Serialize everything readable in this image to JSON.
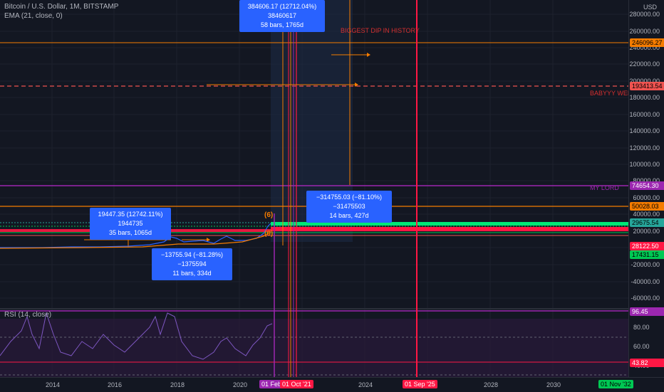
{
  "header": {
    "symbol_title": "Bitcoin / U.S. Dollar, 1M, BITSTAMP",
    "ema_label": "EMA (21, close, 0)",
    "rsi_label": "RSI (14, close)"
  },
  "price_axis": {
    "currency": "USD",
    "ticks": [
      "280000.00",
      "260000.00",
      "240000.00",
      "220000.00",
      "200000.00",
      "180000.00",
      "160000.00",
      "140000.00",
      "120000.00",
      "100000.00",
      "80000.00",
      "60000.00",
      "40000.00",
      "20000.00",
      "0.00",
      "-20000.00",
      "-40000.00",
      "-60000.00"
    ],
    "labels": [
      {
        "text": "246096.27",
        "bg": "#f57c00",
        "fg": "#000000"
      },
      {
        "text": "193413.54",
        "bg": "#ef5350",
        "fg": "#000000"
      },
      {
        "text": "74654.30",
        "bg": "#9c27b0",
        "fg": "#ffffff"
      },
      {
        "text": "50028.03",
        "bg": "#f57c00",
        "fg": "#000000"
      },
      {
        "text": "29675.54",
        "bg": "#26a69a",
        "fg": "#000000"
      },
      {
        "text": "28122.50",
        "bg": "#ff1744",
        "fg": "#ffffff"
      },
      {
        "text": "17431.15",
        "bg": "#00c853",
        "fg": "#000000"
      }
    ]
  },
  "rsi_axis": {
    "ticks": [
      "80.00",
      "60.00",
      "40.00"
    ],
    "labels": [
      {
        "text": "96.45",
        "bg": "#9c27b0",
        "fg": "#ffffff"
      },
      {
        "text": "43.82",
        "bg": "#ff1744",
        "fg": "#ffffff"
      }
    ]
  },
  "time_axis": {
    "ticks": [
      "2014",
      "2016",
      "2018",
      "2020",
      "2022",
      "2024",
      "2026",
      "2028",
      "2030"
    ],
    "markers": [
      {
        "text": "01 Feb '21",
        "bg": "#9c27b0",
        "fg": "#ffffff"
      },
      {
        "text": "01 Oct '21",
        "bg": "#ff1744",
        "fg": "#ffffff"
      },
      {
        "text": "01 Sep '25",
        "bg": "#ff1744",
        "fg": "#ffffff"
      },
      {
        "text": "01 Nov '32",
        "bg": "#00c853",
        "fg": "#000000"
      }
    ]
  },
  "annotations": {
    "biggest_dip": "BIGGEST DIP IN HISTORY",
    "babyyy": "BABYYY WELC",
    "my_lord": "MY LORD",
    "wave_marker": "(6)"
  },
  "measure_boxes": [
    {
      "line1": "384606.17 (12712.04%) 38460617",
      "line2": "58 bars, 1765d"
    },
    {
      "line1": "19447.35 (12742.11%) 1944735",
      "line2": "35 bars, 1065d"
    },
    {
      "line1": "−13755.94 (−81.28%) −1375594",
      "line2": "11 bars, 334d"
    },
    {
      "line1": "−314755.03 (−81.10%) −31475503",
      "line2": "14 bars, 427d"
    }
  ],
  "colors": {
    "background": "#131722",
    "grid": "#1e222d",
    "orange": "#f57c00",
    "red": "#ff1744",
    "purple": "#9c27b0",
    "green": "#00c853",
    "blue": "#2962ff"
  }
}
